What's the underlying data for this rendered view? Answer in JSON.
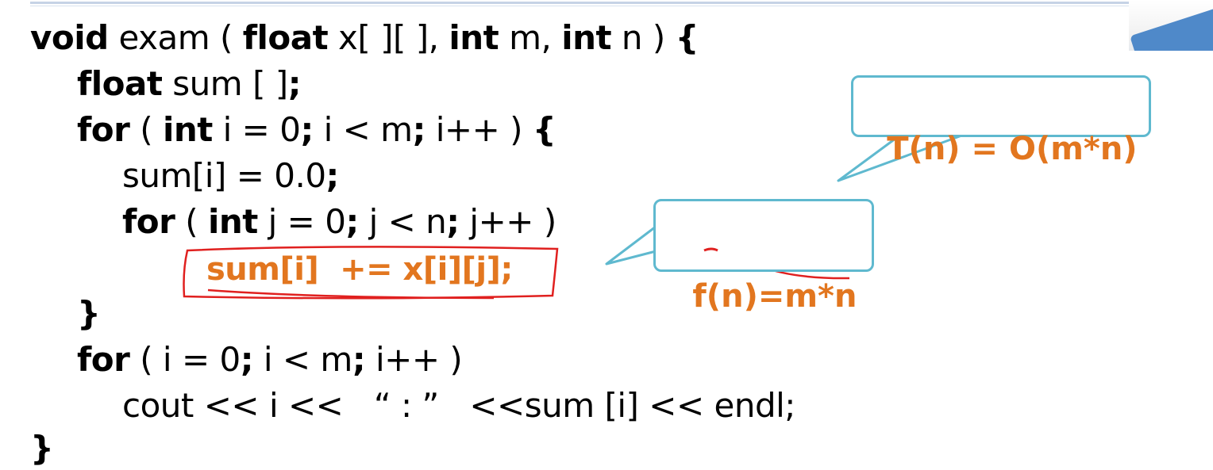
{
  "code": {
    "line1": {
      "kw_void": "void",
      "t1": " exam ( ",
      "kw_float": "float",
      "t2": " x[ ][ ], ",
      "kw_int1": "int",
      "t3": " m, ",
      "kw_int2": "int",
      "t4": " n ) ",
      "brace": "{"
    },
    "line2": {
      "kw_float": "float",
      "t1": " sum [ ]",
      "semi": ";"
    },
    "line3": {
      "kw_for": "for",
      "t1": " ( ",
      "kw_int": "int",
      "t2": " i = 0",
      "semi1": ";",
      "t3": " i < m",
      "semi2": ";",
      "t4": " i++ ) ",
      "brace": "{"
    },
    "line4": {
      "t1": "sum[i] = 0.0",
      "semi": ";"
    },
    "line5": {
      "kw_for": "for",
      "t1": " ( ",
      "kw_int": "int",
      "t2": " j = 0",
      "semi1": ";",
      "t3": " j < n",
      "semi2": ";",
      "t4": " j++ )"
    },
    "line6": {
      "text": "sum[i]  += x[i][j];"
    },
    "line7": {
      "brace": "}"
    },
    "line8": {
      "kw_for": "for",
      "t1": " ( i = 0",
      "semi1": ";",
      "t2": " i < m",
      "semi2": ";",
      "t3": " i++ )"
    },
    "line9": {
      "text": "cout << i <<   “ : ”   <<sum [i] << endl;"
    },
    "line10": {
      "brace": "}"
    }
  },
  "callouts": {
    "complexity": "T(n) = O(m*n)",
    "frequency": "f(n)=m*n"
  },
  "colors": {
    "highlight": "#e2761f",
    "callout_border": "#5fb9cf",
    "annotation_red": "#e0201f"
  }
}
